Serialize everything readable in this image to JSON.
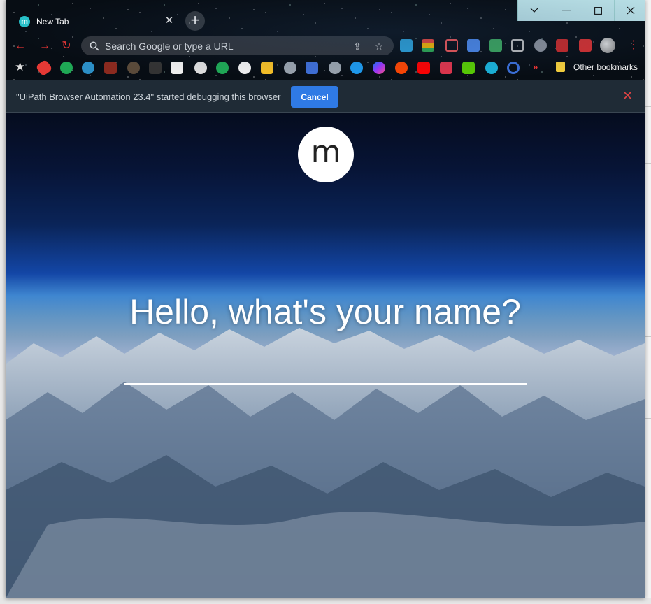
{
  "tab": {
    "favicon_letter": "m",
    "title": "New Tab",
    "favicon_color": "#27c0c8"
  },
  "window_controls": {
    "icons": [
      "tab-search-icon",
      "minimize-icon",
      "maximize-icon",
      "close-icon"
    ]
  },
  "toolbar": {
    "omnibox_placeholder": "Search Google or type a URL"
  },
  "bookmarks": {
    "overflow_label": "»",
    "other_bookmarks_label": "Other bookmarks"
  },
  "infobar": {
    "message": "\"UiPath Browser Automation 23.4\" started debugging this browser",
    "cancel_label": "Cancel",
    "accent": "#2f7ae5"
  },
  "page": {
    "logo_letter": "m",
    "greeting": "Hello, what's your name?",
    "name_value": ""
  }
}
